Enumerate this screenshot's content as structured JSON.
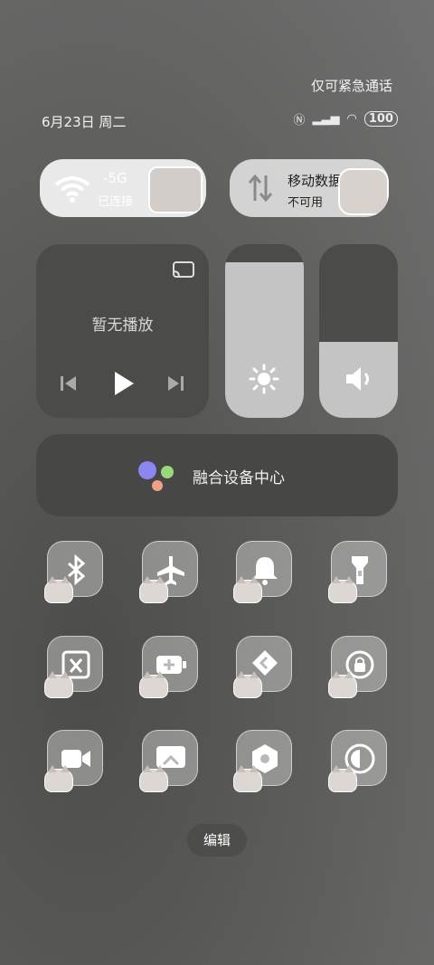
{
  "status": {
    "emergency_text": "仅可紧急通话",
    "date_text": "6月23日 周二",
    "battery": "100"
  },
  "wifi_tile": {
    "title": "-5G",
    "subtitle": "已连接"
  },
  "data_tile": {
    "title": "移动数据",
    "subtitle": "不可用"
  },
  "media": {
    "label": "暂无播放"
  },
  "brightness": {
    "level": 0.95
  },
  "volume": {
    "level": 0.44
  },
  "device_hub": {
    "label": "融合设备中心"
  },
  "toggles": [
    {
      "icon": "bluetooth-icon"
    },
    {
      "icon": "airplane-icon"
    },
    {
      "icon": "bell-icon"
    },
    {
      "icon": "flashlight-icon"
    },
    {
      "icon": "screenshot-icon"
    },
    {
      "icon": "battery-saver-icon"
    },
    {
      "icon": "share-icon"
    },
    {
      "icon": "rotation-lock-icon"
    },
    {
      "icon": "screen-record-icon"
    },
    {
      "icon": "screen-cast-icon"
    },
    {
      "icon": "settings-icon"
    },
    {
      "icon": "eye-comfort-icon"
    }
  ],
  "edit_label": "编辑"
}
